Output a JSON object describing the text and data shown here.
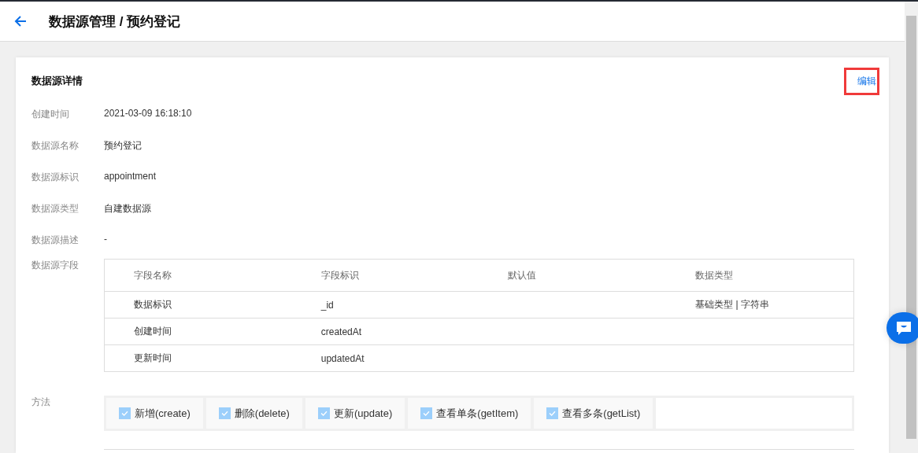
{
  "header": {
    "title": "数据源管理 / 预约登记"
  },
  "card": {
    "title": "数据源详情",
    "edit_link": "编辑",
    "highlighted": true
  },
  "details": [
    {
      "label": "创建时间",
      "value": "2021-03-09 16:18:10"
    },
    {
      "label": "数据源名称",
      "value": "预约登记"
    },
    {
      "label": "数据源标识",
      "value": "appointment"
    },
    {
      "label": "数据源类型",
      "value": "自建数据源"
    },
    {
      "label": "数据源描述",
      "value": "-"
    }
  ],
  "fields": {
    "label": "数据源字段",
    "columns": [
      "字段名称",
      "字段标识",
      "默认值",
      "数据类型"
    ],
    "rows": [
      [
        "数据标识",
        "_id",
        "",
        "基础类型 | 字符串"
      ],
      [
        "创建时间",
        "createdAt",
        "",
        ""
      ],
      [
        "更新时间",
        "updatedAt",
        "",
        ""
      ]
    ]
  },
  "methods": {
    "label": "方法",
    "items": [
      {
        "label": "新增(create)",
        "checked": true
      },
      {
        "label": "删除(delete)",
        "checked": true
      },
      {
        "label": "更新(update)",
        "checked": true
      },
      {
        "label": "查看单条(getItem)",
        "checked": true
      },
      {
        "label": "查看多条(getList)",
        "checked": true
      }
    ]
  }
}
